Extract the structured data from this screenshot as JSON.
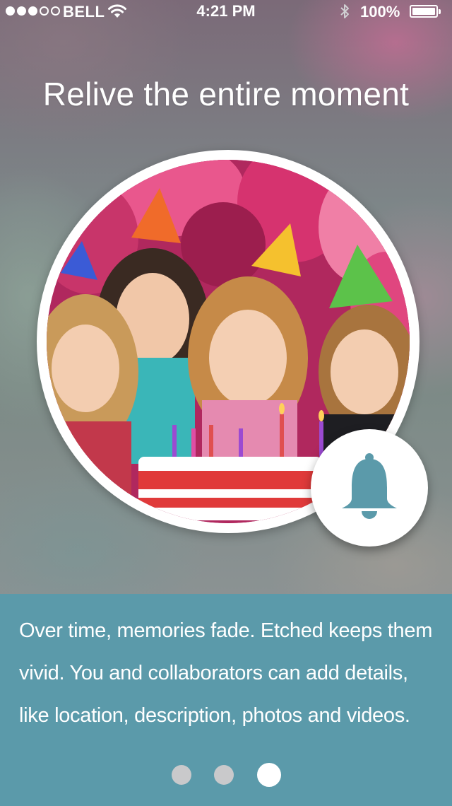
{
  "status_bar": {
    "carrier": "BELL",
    "time": "4:21 PM",
    "battery_percent": "100%",
    "signal_bars": 3,
    "signal_total": 5,
    "icons": [
      "wifi-icon",
      "bluetooth-icon",
      "battery-icon"
    ]
  },
  "onboarding": {
    "headline": "Relive the entire moment",
    "photo_subject": "birthday-party-photo",
    "badge_icon": "bell-icon",
    "description": "Over time, memories fade.  Etched keeps them vivid.  You and collaborators can add details, like location, description, photos and videos.",
    "pager": {
      "total_pages": 3,
      "current_page": 3
    }
  },
  "colors": {
    "panel_background": "#5b9aaa",
    "bell_color": "#5b9aaa",
    "text": "#ffffff",
    "page_dot_inactive": "#c9c9cb",
    "page_dot_active": "#ffffff"
  }
}
